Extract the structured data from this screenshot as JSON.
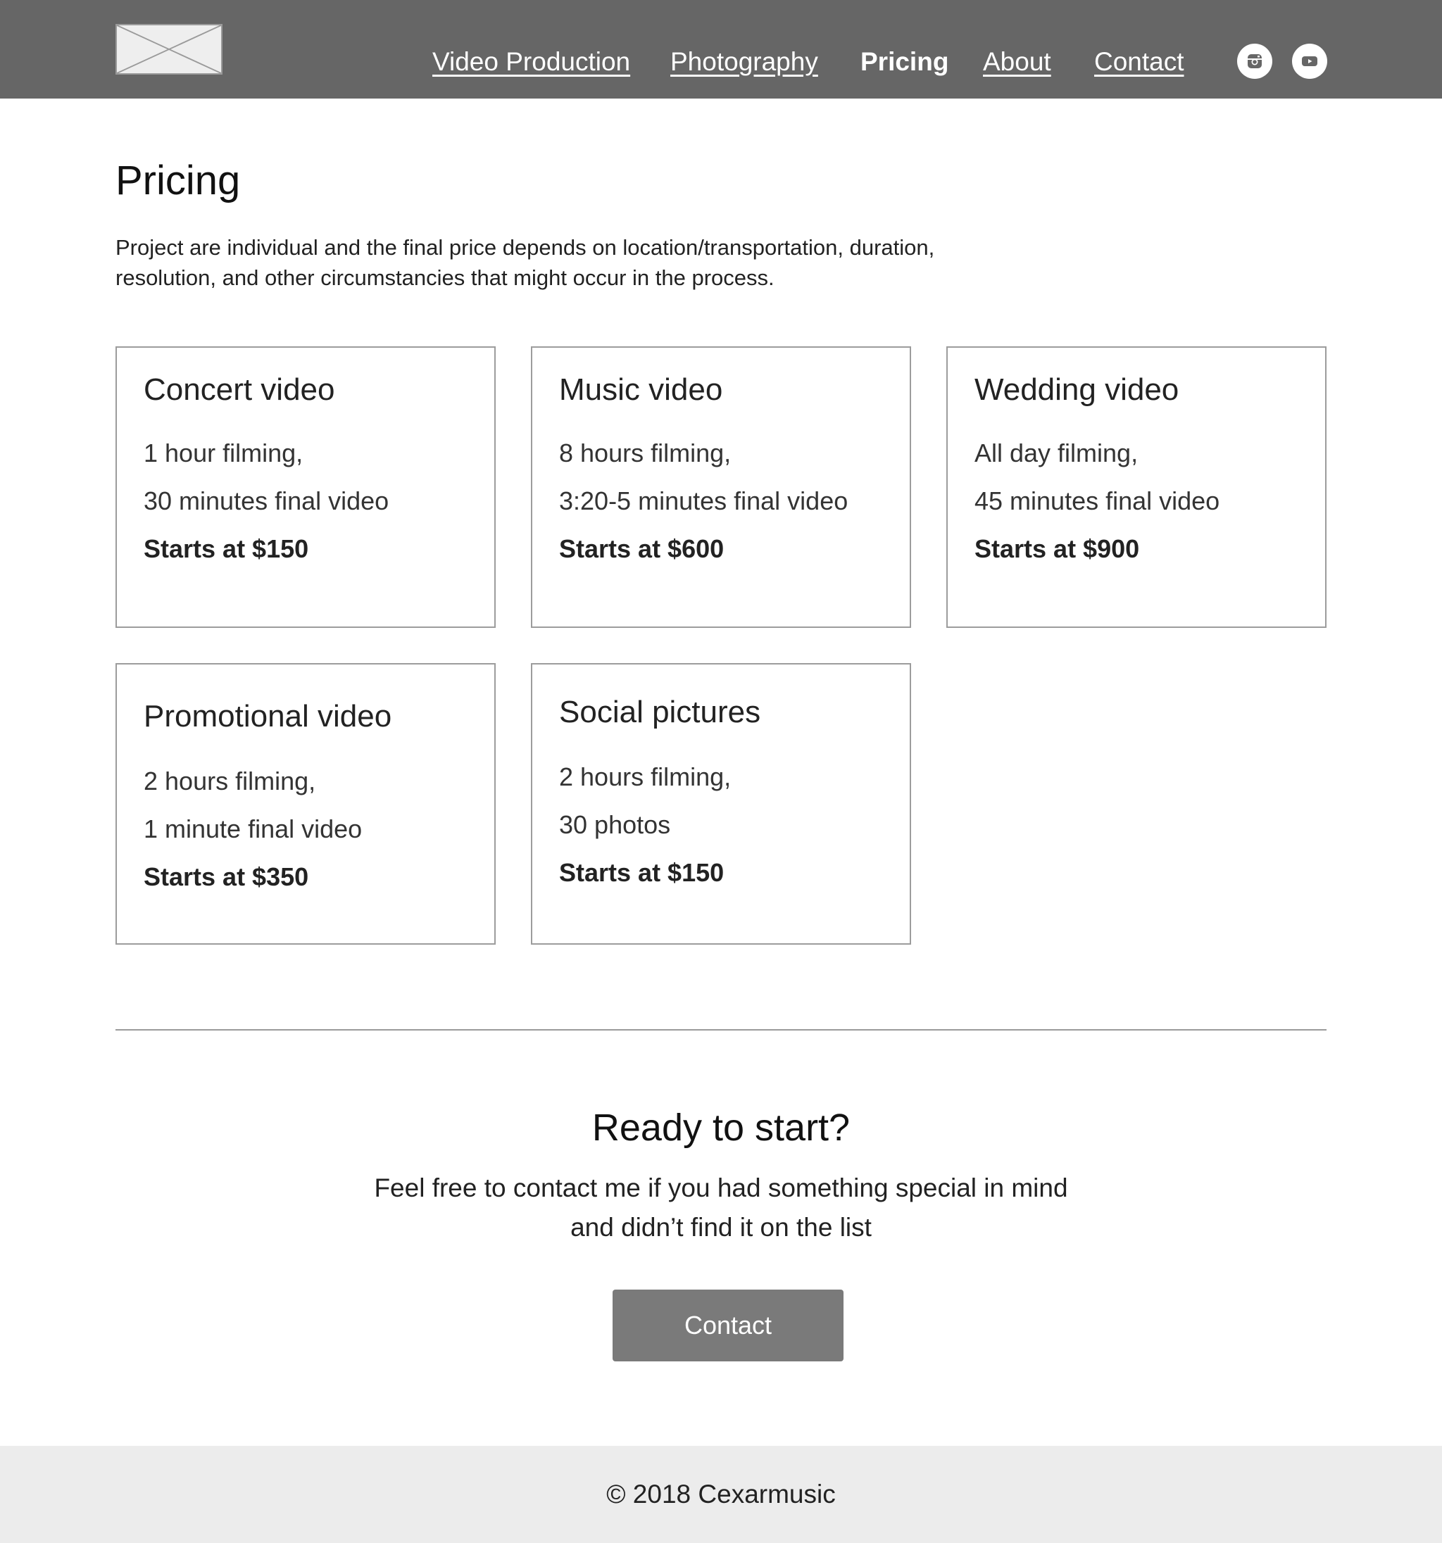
{
  "header": {
    "nav": [
      {
        "label": "Video Production"
      },
      {
        "label": "Photography"
      },
      {
        "label": "Pricing"
      },
      {
        "label": "About"
      },
      {
        "label": "Contact"
      }
    ],
    "social": [
      "instagram-icon",
      "youtube-icon"
    ],
    "background_color": "#666666"
  },
  "page": {
    "title": "Pricing",
    "intro": "Project are individual and the final price depends on location/transportation, duration, resolution, and other circumstancies that might occur in the process."
  },
  "cards": [
    {
      "title": "Concert video",
      "line1": "1 hour filming,",
      "line2": "30 minutes final video",
      "price": "Starts at $150"
    },
    {
      "title": "Music video",
      "line1": "8 hours filming,",
      "line2": "3:20-5 minutes final video",
      "price": "Starts at $600"
    },
    {
      "title": "Wedding video",
      "line1": "All day filming,",
      "line2": "45 minutes final video",
      "price": "Starts at $900"
    },
    {
      "title": "Promotional video",
      "line1": "2 hours filming,",
      "line2": "1 minute final video",
      "price": "Starts at $350"
    },
    {
      "title": "Social pictures",
      "line1": "2 hours filming,",
      "line2": "30 photos",
      "price": "Starts at $150"
    }
  ],
  "cta": {
    "title": "Ready to start?",
    "text_line1": "Feel free to contact me if you had something special in mind",
    "text_line2": "and didn’t find it on the list",
    "button_label": "Contact",
    "button_color": "#7a7a7a"
  },
  "footer": {
    "text": "© 2018 Cexarmusic",
    "background_color": "#ececec"
  }
}
